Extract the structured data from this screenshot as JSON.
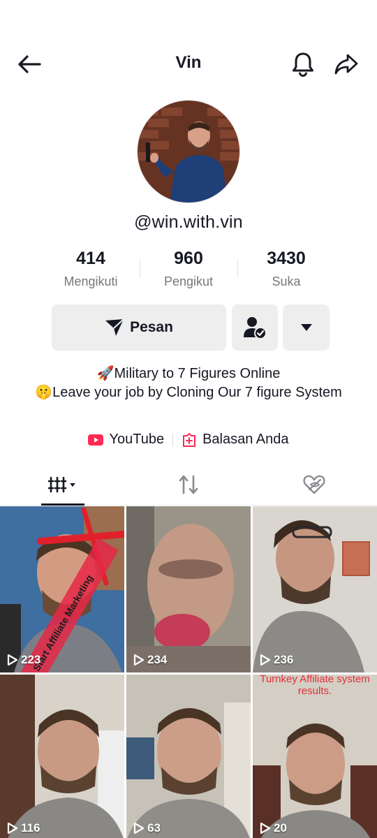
{
  "header": {
    "title": "Vin"
  },
  "profile": {
    "handle": "@win.with.vin"
  },
  "stats": [
    {
      "value": "414",
      "label": "Mengikuti"
    },
    {
      "value": "960",
      "label": "Pengikut"
    },
    {
      "value": "3430",
      "label": "Suka"
    }
  ],
  "actions": {
    "message_label": "Pesan"
  },
  "bio": {
    "line1": "🚀Military to 7 Figures Online",
    "line2": "🤫Leave your job by Cloning Our 7 figure System"
  },
  "links": {
    "youtube_label": "YouTube",
    "reply_label": "Balasan Anda"
  },
  "videos": [
    {
      "views": "223",
      "overlay": "Start Affiliate Marketing"
    },
    {
      "views": "234"
    },
    {
      "views": "236"
    },
    {
      "views": "116"
    },
    {
      "views": "63"
    },
    {
      "views": "20",
      "overlay": "Turnkey Affiliate system results."
    }
  ],
  "colors": {
    "accent_red": "#fe2c55",
    "text_primary": "#161823",
    "button_bg": "#eeeeee"
  }
}
